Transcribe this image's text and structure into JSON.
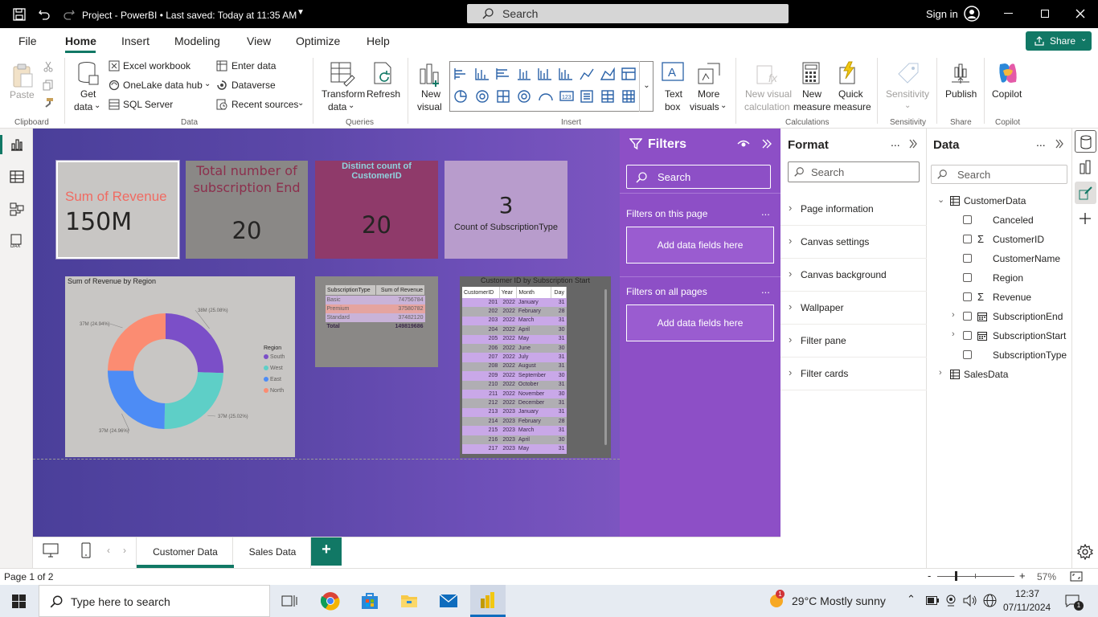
{
  "titlebar": {
    "title": "Project - PowerBI • Last saved: Today at 11:35 AM",
    "search": "Search",
    "signin": "Sign in"
  },
  "menu": [
    "File",
    "Home",
    "Insert",
    "Modeling",
    "View",
    "Optimize",
    "Help"
  ],
  "share": "Share",
  "ribbon": {
    "paste": "Paste",
    "clipboard": "Clipboard",
    "get_data": "Get",
    "get_data2": "data",
    "excel": "Excel workbook",
    "onelake": "OneLake data hub",
    "sql": "SQL Server",
    "enter_data": "Enter data",
    "dataverse": "Dataverse",
    "recent": "Recent sources",
    "data_grp": "Data",
    "transform": "Transform",
    "transform2": "data",
    "refresh": "Refresh",
    "queries": "Queries",
    "new_visual": "New",
    "new_visual2": "visual",
    "text_box": "Text",
    "text_box2": "box",
    "more_visuals": "More",
    "more_visuals2": "visuals",
    "insert": "Insert",
    "new_visual_calc": "New visual",
    "new_visual_calc2": "calculation",
    "new_measure": "New",
    "new_measure2": "measure",
    "quick_measure": "Quick",
    "quick_measure2": "measure",
    "calculations": "Calculations",
    "sensitivity": "Sensitivity",
    "sensitivity_grp": "Sensitivity",
    "publish": "Publish",
    "share_grp": "Share",
    "copilot": "Copilot",
    "copilot_grp": "Copilot"
  },
  "cards": {
    "revenue_label": "Sum of Revenue",
    "revenue_value": "150M",
    "subend_label": "Total number of subscription End",
    "subend_value": "20",
    "distinct_label": "Distinct count of CustomerID",
    "distinct_value": "20",
    "subtype_value": "3",
    "subtype_label": "Count of SubscriptionType"
  },
  "donut": {
    "title": "Sum of Revenue by Region",
    "legend_title": "Region",
    "slices": [
      {
        "name": "South",
        "value": 38,
        "label": "38M (25.08%)",
        "color": "#7b4fc8"
      },
      {
        "name": "West",
        "value": 37,
        "label": "37M (25.02%)",
        "color": "#5ecfc7"
      },
      {
        "name": "East",
        "value": 37,
        "label": "37M (24.96%)",
        "color": "#4d8cf5"
      },
      {
        "name": "North",
        "value": 37,
        "label": "37M (24.94%)",
        "color": "#fb8c72"
      }
    ]
  },
  "revenue_table": {
    "headers": [
      "SubscriptionType",
      "Sum of Revenue"
    ],
    "rows": [
      [
        "Basic",
        "74756784"
      ],
      [
        "Premium",
        "37580782"
      ],
      [
        "Standard",
        "37482120"
      ]
    ],
    "total": [
      "Total",
      "149819686"
    ]
  },
  "customer_table": {
    "title": "Customer ID by Subscription Start",
    "headers": [
      "CustomerID",
      "Year",
      "Month",
      "Day"
    ],
    "rows": [
      [
        "201",
        "2022",
        "January",
        "31"
      ],
      [
        "202",
        "2022",
        "February",
        "28"
      ],
      [
        "203",
        "2022",
        "March",
        "31"
      ],
      [
        "204",
        "2022",
        "April",
        "30"
      ],
      [
        "205",
        "2022",
        "May",
        "31"
      ],
      [
        "206",
        "2022",
        "June",
        "30"
      ],
      [
        "207",
        "2022",
        "July",
        "31"
      ],
      [
        "208",
        "2022",
        "August",
        "31"
      ],
      [
        "209",
        "2022",
        "September",
        "30"
      ],
      [
        "210",
        "2022",
        "October",
        "31"
      ],
      [
        "211",
        "2022",
        "November",
        "30"
      ],
      [
        "212",
        "2022",
        "December",
        "31"
      ],
      [
        "213",
        "2023",
        "January",
        "31"
      ],
      [
        "214",
        "2023",
        "February",
        "28"
      ],
      [
        "215",
        "2023",
        "March",
        "31"
      ],
      [
        "216",
        "2023",
        "April",
        "30"
      ],
      [
        "217",
        "2023",
        "May",
        "31"
      ]
    ]
  },
  "filters": {
    "title": "Filters",
    "search": "Search",
    "on_page": "Filters on this page",
    "add1": "Add data fields here",
    "all_pages": "Filters on all pages",
    "add2": "Add data fields here",
    "more1": "...",
    "more2": "..."
  },
  "format": {
    "title": "Format",
    "search": "Search",
    "more": "...",
    "sections": [
      "Page information",
      "Canvas settings",
      "Canvas background",
      "Wallpaper",
      "Filter pane",
      "Filter cards"
    ]
  },
  "data": {
    "title": "Data",
    "search": "Search",
    "more": "...",
    "table1": "CustomerData",
    "fields": [
      "Canceled",
      "CustomerID",
      "CustomerName",
      "Region",
      "Revenue",
      "SubscriptionEnd",
      "SubscriptionStart",
      "SubscriptionType"
    ],
    "table2": "SalesData"
  },
  "tabs": [
    "Customer Data",
    "Sales Data"
  ],
  "add_tab": "+",
  "status": {
    "page": "Page 1 of 2",
    "zoom": "57%",
    "zoom_minus": "-",
    "zoom_plus": "+"
  },
  "taskbar": {
    "search": "Type here to search",
    "weather": "29°C  Mostly sunny",
    "time": "12:37",
    "date": "07/11/2024",
    "notif": "1",
    "weather_badge": "1"
  }
}
